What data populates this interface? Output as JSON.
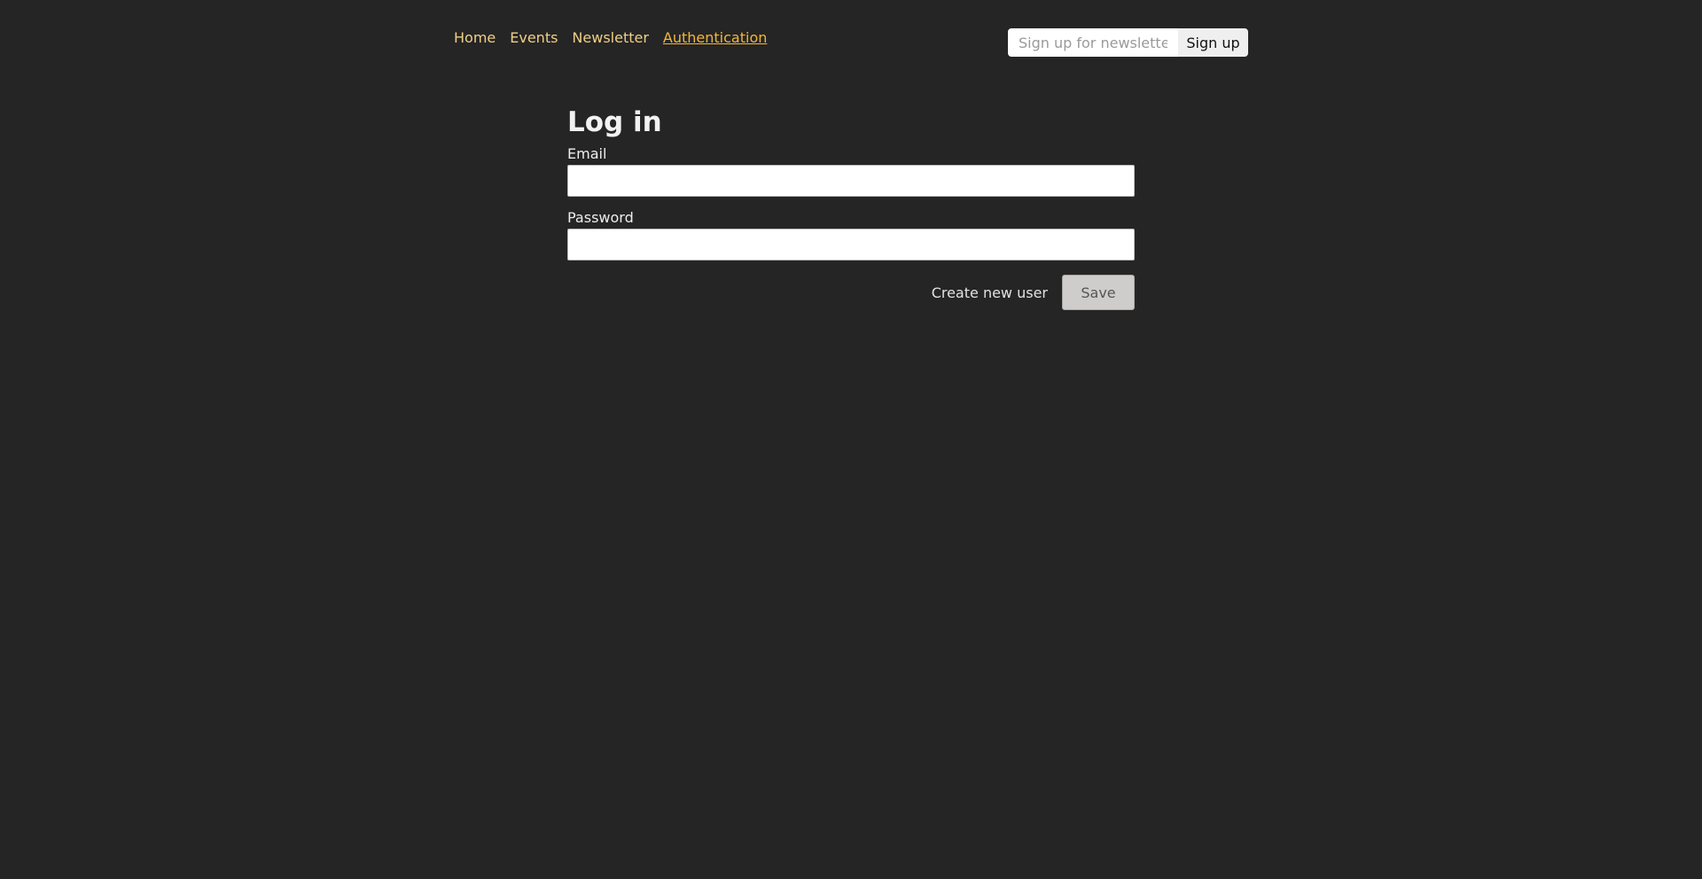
{
  "nav": {
    "items": [
      {
        "label": "Home",
        "active": false
      },
      {
        "label": "Events",
        "active": false
      },
      {
        "label": "Newsletter",
        "active": false
      },
      {
        "label": "Authentication",
        "active": true
      }
    ]
  },
  "newsletter": {
    "placeholder": "Sign up for newsletter...",
    "value": "",
    "button_label": "Sign up"
  },
  "form": {
    "title": "Log in",
    "email_label": "Email",
    "email_value": "",
    "password_label": "Password",
    "password_value": "",
    "create_user_label": "Create new user",
    "save_label": "Save"
  },
  "colors": {
    "background": "#252525",
    "nav_link": "#f0cf86",
    "nav_active": "#f3b63a",
    "save_button": "#cfcdcb"
  }
}
